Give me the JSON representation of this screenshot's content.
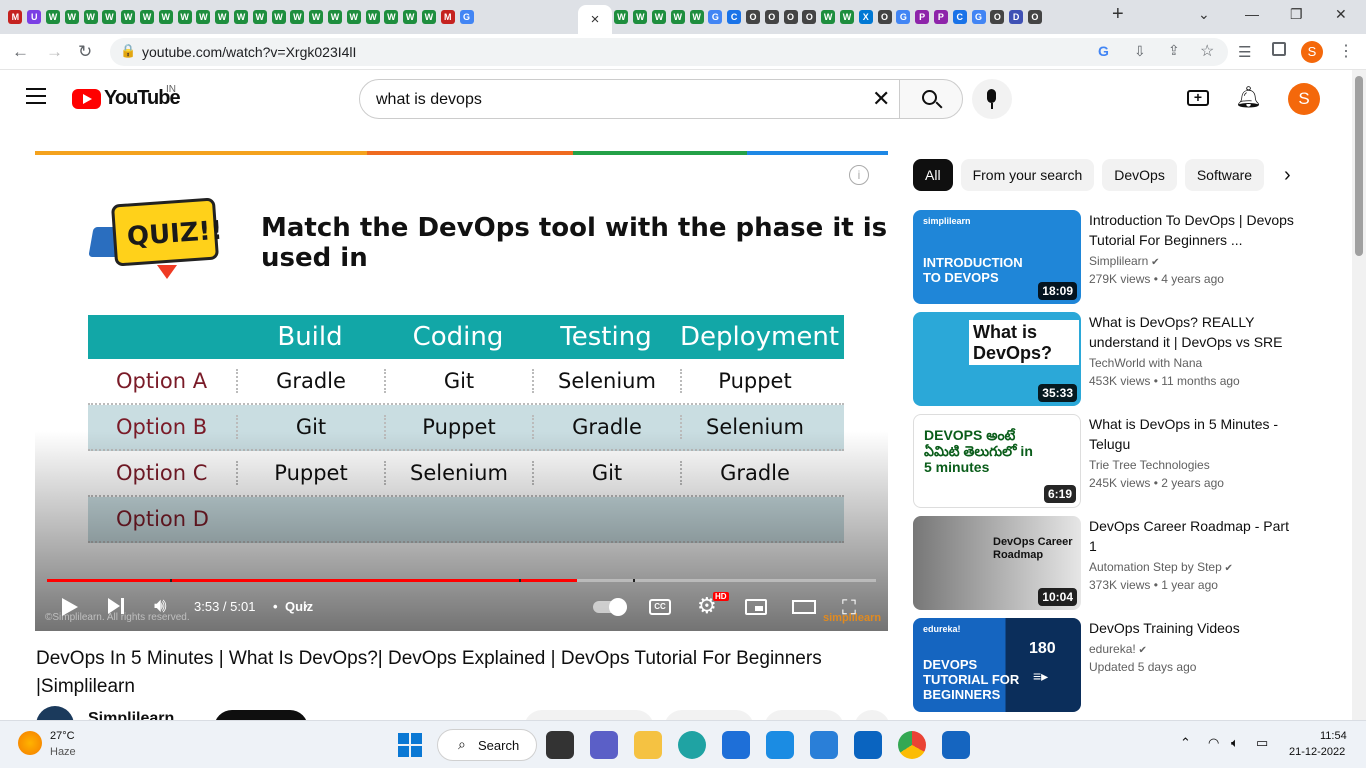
{
  "browser": {
    "tabs": [
      "M",
      "U",
      "W",
      "W",
      "W",
      "W",
      "W",
      "W",
      "W",
      "W",
      "W",
      "W",
      "W",
      "W",
      "W",
      "W",
      "W",
      "W",
      "W",
      "W",
      "W",
      "W",
      "W",
      "M",
      "G"
    ],
    "active_tab_close": "×",
    "tabs_right": [
      "W",
      "W",
      "W",
      "W",
      "W",
      "G",
      "C",
      "O",
      "O",
      "O",
      "O",
      "W",
      "W",
      "X",
      "O",
      "G",
      "P",
      "P",
      "C",
      "G",
      "O",
      "D",
      "O"
    ],
    "new_tab": "+",
    "url": "youtube.com/watch?v=Xrgk023I4lI",
    "profile_letter": "S"
  },
  "youtube": {
    "logo": "YouTube",
    "region": "IN",
    "search_value": "what is devops",
    "avatar": "S"
  },
  "player": {
    "slide_title": "Match the DevOps tool with the phase it is used in",
    "quiz_badge": "QUIZ!!",
    "columns": [
      "",
      "Build",
      "Coding",
      "Testing",
      "Deployment"
    ],
    "rows": [
      [
        "Option A",
        "Gradle",
        "Git",
        "Selenium",
        "Puppet"
      ],
      [
        "Option B",
        "Git",
        "Puppet",
        "Gradle",
        "Selenium"
      ],
      [
        "Option C",
        "Puppet",
        "Selenium",
        "Git",
        "Gradle"
      ],
      [
        "Option D",
        "",
        "",
        "",
        ""
      ]
    ],
    "time": "3:53 / 5:01",
    "chapter": "Quiz",
    "progress": 0.77,
    "watermark": "©Simplilearn. All rights reserved.",
    "brand": "simplilearn",
    "hd_badge": "HD"
  },
  "video": {
    "title": "DevOps In 5 Minutes | What Is DevOps?| DevOps Explained | DevOps Tutorial For Beginners |Simplilearn",
    "channel": "Simplilearn"
  },
  "chips": [
    "All",
    "From your search",
    "DevOps",
    "Software"
  ],
  "recommendations": [
    {
      "title": "Introduction To DevOps | Devops Tutorial For Beginners ...",
      "channel": "Simplilearn",
      "verified": true,
      "meta": "279K views  • 4 years ago",
      "duration": "18:09",
      "thumb_text": "INTRODUCTION TO DEVOPS",
      "thumb_brand": "simplilearn",
      "color": "#1f86d8"
    },
    {
      "title": "What is DevOps? REALLY understand it | DevOps vs SRE",
      "channel": "TechWorld with Nana",
      "verified": false,
      "meta": "453K views  • 11 months ago",
      "duration": "35:33",
      "thumb_text": "What is DevOps?",
      "thumb_brand": "",
      "color": "#2ba8d8"
    },
    {
      "title": "What is DevOps in 5 Minutes - Telugu",
      "channel": "Trie Tree Technologies",
      "verified": false,
      "meta": "245K views  • 2 years ago",
      "duration": "6:19",
      "thumb_text": "DEVOPS అంటే ఏమిటి తెలుగులో in 5 minutes",
      "thumb_brand": "",
      "color": "#ffffff"
    },
    {
      "title": "DevOps Career Roadmap - Part 1",
      "channel": "Automation Step by Step",
      "verified": true,
      "meta": "373K views  • 1 year ago",
      "duration": "10:04",
      "thumb_text": "DevOps Career Roadmap",
      "thumb_brand": "",
      "color": "#dcdcdc"
    },
    {
      "title": "DevOps Training Videos",
      "channel": "edureka!",
      "verified": true,
      "meta": "Updated 5 days ago",
      "duration": "",
      "thumb_text": "DEVOPS TUTORIAL FOR BEGINNERS",
      "thumb_brand": "edureka!",
      "playlist_count": "180",
      "color": "#1565c0"
    }
  ],
  "taskbar": {
    "weather_temp": "27°C",
    "weather_desc": "Haze",
    "search_label": "Search",
    "time": "11:54",
    "date": "21-12-2022"
  },
  "colors": {
    "yt_red": "#ff0000",
    "teal": "#12a7a7",
    "avatar_orange": "#f4680b"
  }
}
